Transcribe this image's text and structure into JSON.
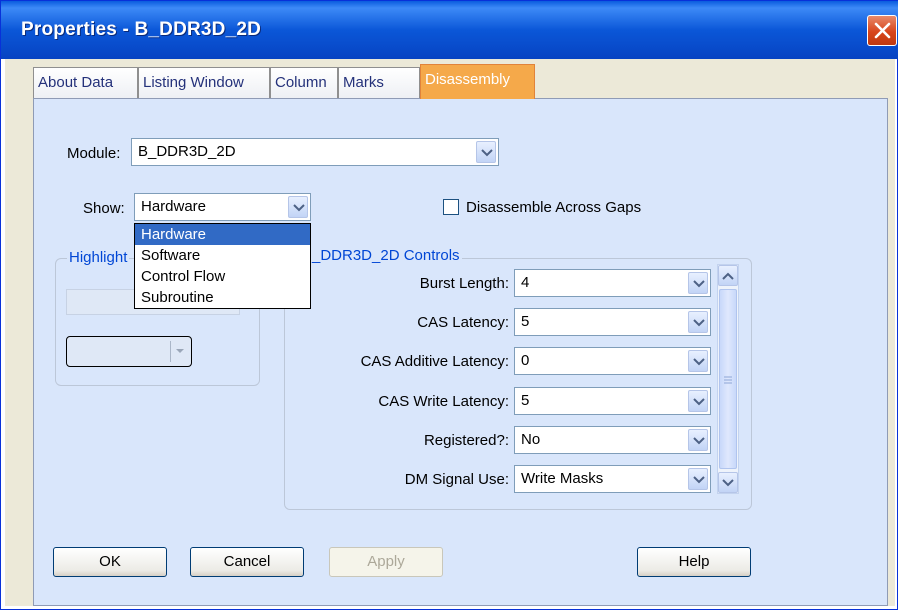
{
  "window": {
    "title": "Properties - B_DDR3D_2D"
  },
  "tabs": [
    {
      "label": "About Data"
    },
    {
      "label": "Listing Window"
    },
    {
      "label": "Column"
    },
    {
      "label": "Marks"
    },
    {
      "label": "Disassembly",
      "active": true
    }
  ],
  "form": {
    "module_label": "Module:",
    "module_value": "B_DDR3D_2D",
    "show_label": "Show:",
    "show_value": "Hardware",
    "show_options": [
      "Hardware",
      "Software",
      "Control Flow",
      "Subroutine"
    ],
    "show_selected_option": "Hardware",
    "disassemble_gaps_label": "Disassemble Across Gaps",
    "disassemble_gaps_checked": false
  },
  "highlight_group": {
    "label": "Highlight"
  },
  "controls_group": {
    "label": "_DDR3D_2D Controls",
    "fields": [
      {
        "label": "Burst Length:",
        "value": "4"
      },
      {
        "label": "CAS Latency:",
        "value": "5"
      },
      {
        "label": "CAS Additive Latency:",
        "value": "0"
      },
      {
        "label": "CAS Write Latency:",
        "value": "5"
      },
      {
        "label": "Registered?:",
        "value": "No"
      },
      {
        "label": "DM Signal Use:",
        "value": "Write Masks"
      }
    ]
  },
  "buttons": {
    "ok": "OK",
    "cancel": "Cancel",
    "apply": "Apply",
    "help": "Help"
  },
  "colors": {
    "titlebar": "#0b57d8",
    "active_tab": "#f5a94a",
    "panel": "#d9e6fb",
    "selection": "#316ac5",
    "group_label": "#0046d5"
  }
}
